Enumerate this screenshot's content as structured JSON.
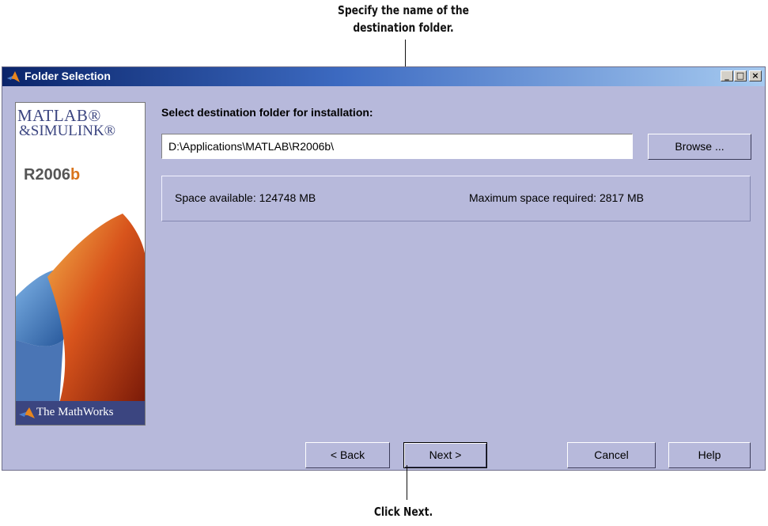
{
  "callouts": {
    "top": "Specify the name of the destination folder.",
    "bottom": "Click Next."
  },
  "window": {
    "title": "Folder Selection",
    "controls": {
      "minimize": "_",
      "maximize": "□",
      "close": "×"
    }
  },
  "sidebar": {
    "brand_line1": "MATLAB®",
    "brand_line2": "&SIMULINK®",
    "release_prefix": "R2006",
    "release_suffix": "b",
    "company": "The MathWorks",
    "colors": {
      "band": "#3b4580",
      "accent": "#d9741c"
    },
    "icons": [
      "matlab-peaks-logo",
      "mathworks-membrane-logo"
    ]
  },
  "main": {
    "prompt": "Select destination folder for installation:",
    "folder_path": "D:\\Applications\\MATLAB\\R2006b\\",
    "browse_label": "Browse ...",
    "space_available": "Space available: 124748 MB",
    "space_required": "Maximum space required: 2817 MB"
  },
  "footer": {
    "back_label": "< Back",
    "next_label": "Next >",
    "cancel_label": "Cancel",
    "help_label": "Help"
  },
  "colors": {
    "dialog_bg": "#b7b9db",
    "titlebar_start": "#0a246a",
    "titlebar_end": "#a6caf0"
  }
}
